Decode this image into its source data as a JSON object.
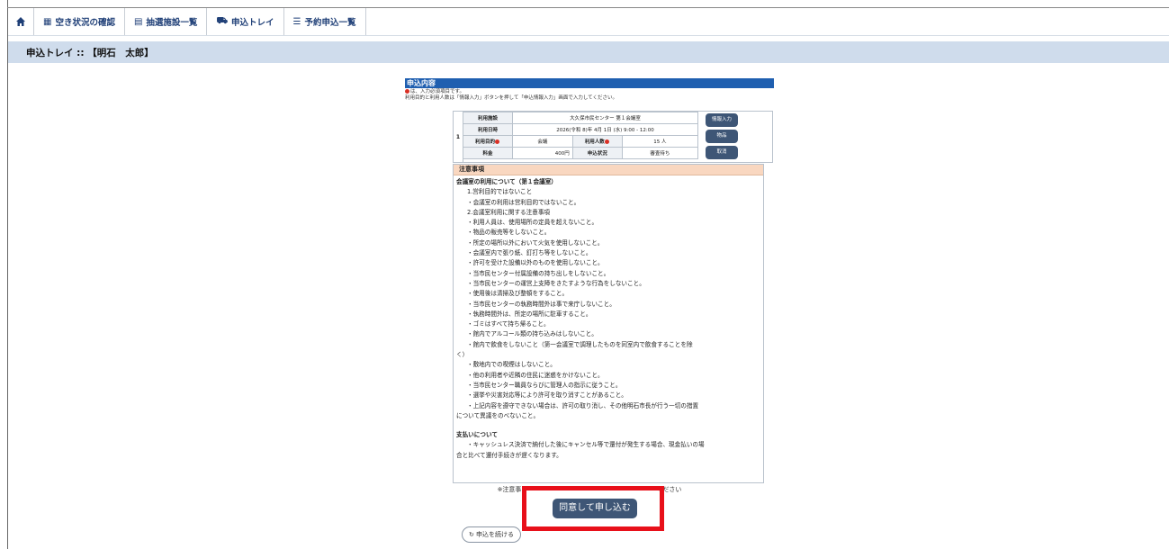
{
  "nav": {
    "home_icon": "home-icon",
    "items": [
      {
        "icon": "calendar-icon",
        "label": "空き状況の確認"
      },
      {
        "icon": "lottery-icon",
        "label": "抽選施設一覧"
      },
      {
        "icon": "cart-icon",
        "label": "申込トレイ"
      },
      {
        "icon": "list-icon",
        "label": "予約申込一覧"
      }
    ]
  },
  "title": "申込トレイ :: 【明石　太郎】",
  "section": {
    "heading": "申込内容",
    "note1": "は、入力必須項目です。",
    "note2": "利用目的と利用人数は「情報入力」ボタンを押して「申込情報入力」画面で入力してください。"
  },
  "tray": {
    "index": "1",
    "rows": [
      {
        "k": "利用施設",
        "v": "大久保市民センター 第１会議室"
      },
      {
        "k": "利用日時",
        "v": "2026(令和 8)年 4月 1日 (水) 9:00 - 12:00"
      }
    ],
    "purpose_label": "利用目的",
    "purpose_value": "会議",
    "people_label": "利用人数",
    "people_value": "15 人",
    "fee_label": "料金",
    "fee_value": "400円",
    "status_label": "申込状況",
    "status_value": "審査待ち",
    "buttons": [
      "情報入力",
      "物品",
      "取消"
    ]
  },
  "notice": {
    "heading": "注意事項",
    "subtitle": "会議室の利用について（第１会議室）",
    "lines": [
      "1.営利目的ではないこと",
      "・会議室の利用は営利目的ではないこと。",
      "2.会議室利用に関する注意事項",
      "・利用人員は、使用場所の定員を超えないこと。",
      "・物品の販売等をしないこと。",
      "・所定の場所以外において火気を使用しないこと。",
      "・会議室内で張り紙、釘打ち等をしないこと。",
      "・許可を受けた設備以外のものを使用しないこと。",
      "・当市民センター付属設備の持ち出しをしないこと。",
      "・当市民センターの運営上支障をきたすような行為をしないこと。",
      "・使用後は清掃及び整頓をすること。",
      "・当市民センターの執務時間外は事で来庁しないこと。",
      "・執務時間外は、所定の場所に駐車すること。",
      "・ゴミはすべて持ち帰ること。",
      "・館内でアルコール類の持ち込みはしないこと。",
      "・館内で飲食をしないこと（第一会議室で調理したものを同室内で飲食することを除",
      "く）",
      "・敷地内での喫煙はしないこと。",
      "・他の利用者や近隣の住民に迷惑をかけないこと。",
      "・当市民センター職員ならびに管理人の指示に従うこと。",
      "・選挙や災害対応等により許可を取り消すことがあること。",
      "・上記内容を遵守できない場合は、許可の取り消し、その他明石市長が行う一切の措置",
      "について異議をのべないこと。"
    ],
    "payment_title": "支払いについて",
    "payment_lines": [
      "・キャッシュレス決済で納付した後にキャンセル等で還付が発生する場合、現金払いの場",
      "合と比べて還付手続きが遅くなります。"
    ]
  },
  "bottom_note_left": "※注意事",
  "bottom_note_right": "ください",
  "agree_button": "同意して申し込む",
  "continue_button": "申込を続ける",
  "colors": {
    "accent": "#1f5fb0",
    "button": "#3e5676",
    "highlight": "#e8101a",
    "notice_head": "#f9d7c0"
  }
}
